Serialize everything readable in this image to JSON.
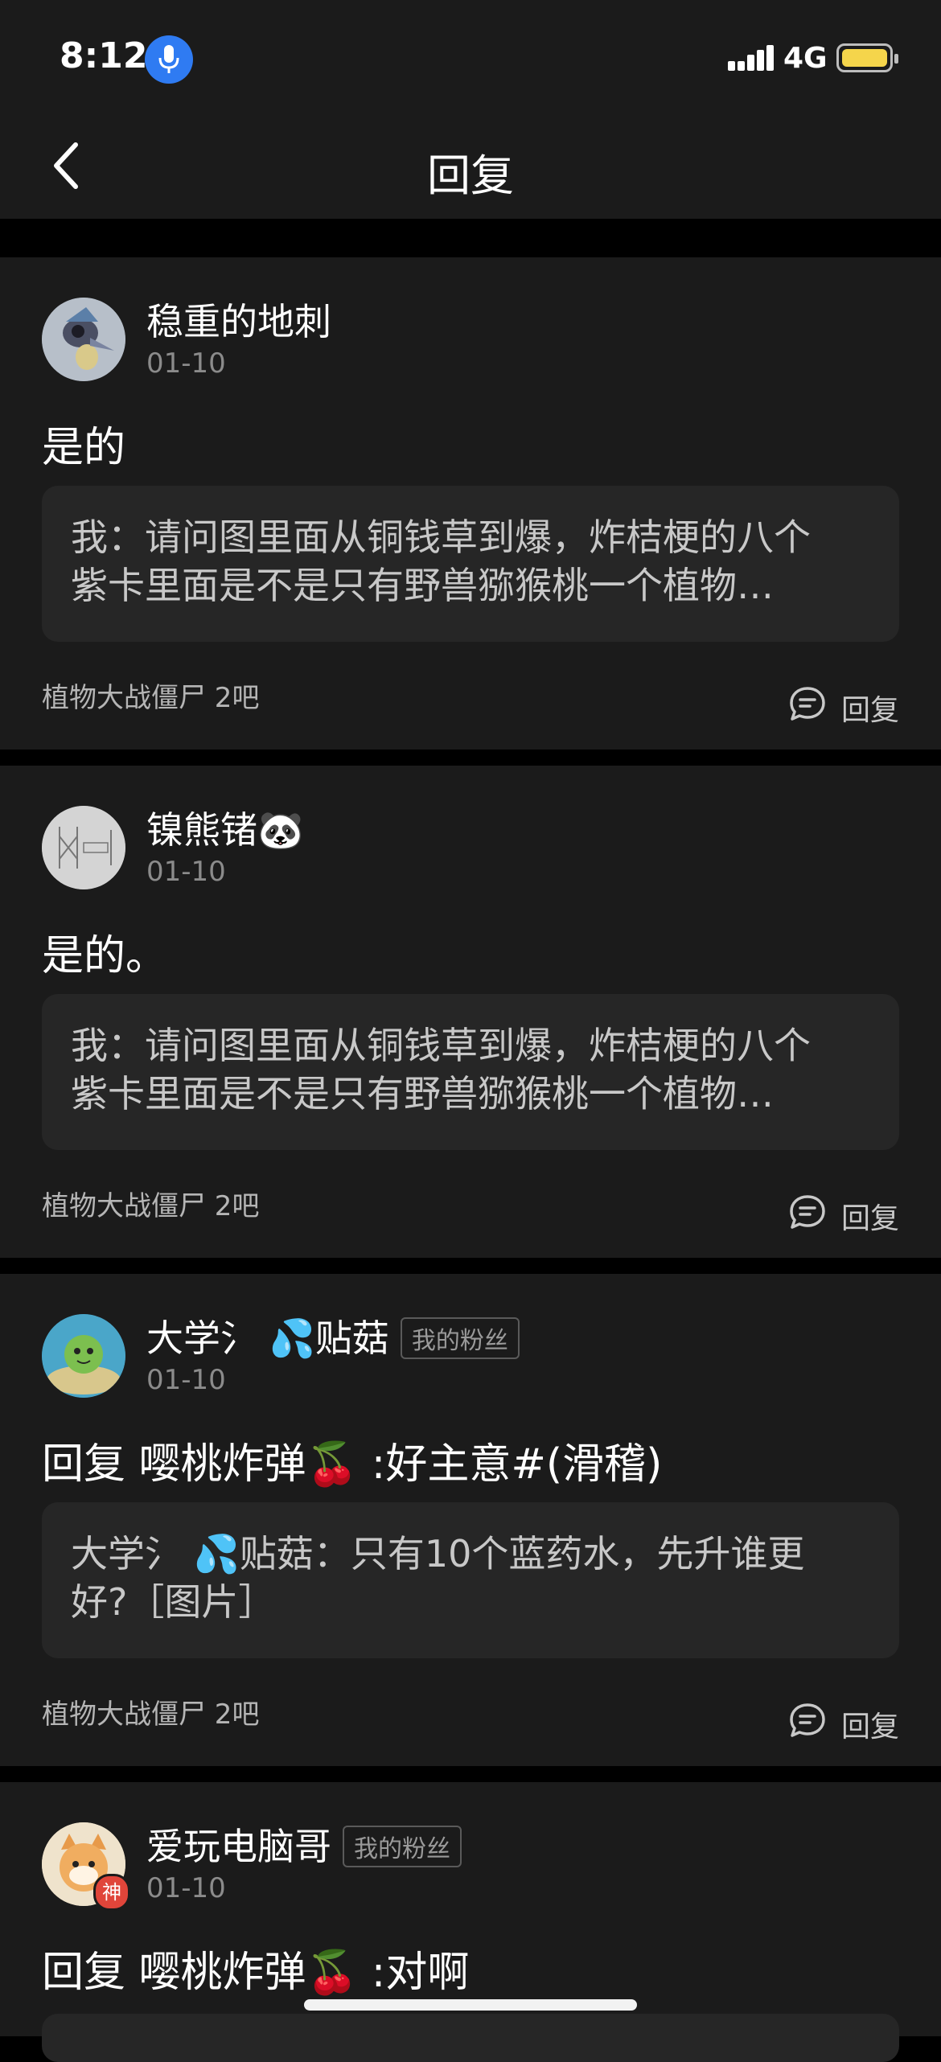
{
  "status_bar": {
    "time": "8:12",
    "network": "4G"
  },
  "header": {
    "title": "回复"
  },
  "posts": [
    {
      "username": "稳重的地刺",
      "date": "01-10",
      "content": "是的",
      "quote_line1": "我：请问图里面从铜钱草到爆，炸桔梗的八个",
      "quote_line2": "紫卡里面是不是只有野兽猕猴桃一个植物…",
      "forum": "植物大战僵尸 2吧",
      "reply_label": "回复"
    },
    {
      "username": "镍熊锗🐼",
      "date": "01-10",
      "content": "是的。",
      "quote_line1": "我：请问图里面从铜钱草到爆，炸桔梗的八个",
      "quote_line2": "紫卡里面是不是只有野兽猕猴桃一个植物…",
      "forum": "植物大战僵尸 2吧",
      "reply_label": "回复"
    },
    {
      "username": "大学氵 💦贴菇",
      "tag": "我的粉丝",
      "date": "01-10",
      "content": "回复  嘤桃炸弹🍒 :好主意#(滑稽)",
      "quote_line1": "大学氵 💦贴菇：只有10个蓝药水，先升谁更",
      "quote_line2": "好?［图片］",
      "forum": "植物大战僵尸 2吧",
      "reply_label": "回复"
    },
    {
      "username": "爱玩电脑哥",
      "tag": "我的粉丝",
      "badge": "神",
      "date": "01-10",
      "content": "回复  嘤桃炸弹🍒 :对啊"
    }
  ]
}
